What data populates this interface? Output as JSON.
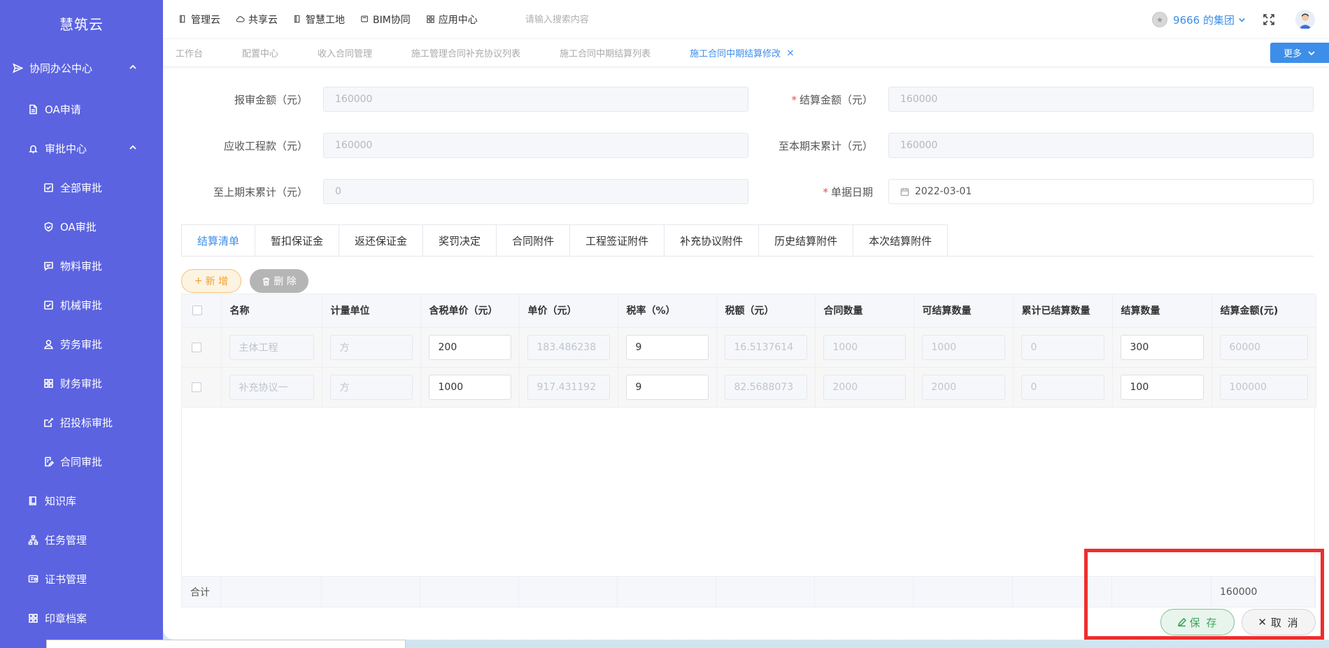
{
  "app": {
    "name": "慧筑云"
  },
  "sidebar": {
    "items": [
      {
        "label": "协同办公中心",
        "level": 1,
        "icon": "send-icon",
        "expanded": true
      },
      {
        "label": "OA申请",
        "level": 2,
        "icon": "document-icon"
      },
      {
        "label": "审批中心",
        "level": 2,
        "icon": "bell-icon",
        "expanded": true
      },
      {
        "label": "全部审批",
        "level": 3,
        "icon": "check-square-icon"
      },
      {
        "label": "OA审批",
        "level": 3,
        "icon": "shield-check-icon"
      },
      {
        "label": "物料审批",
        "level": 3,
        "icon": "message-icon"
      },
      {
        "label": "机械审批",
        "level": 3,
        "icon": "check-square-icon"
      },
      {
        "label": "劳务审批",
        "level": 3,
        "icon": "user-icon"
      },
      {
        "label": "财务审批",
        "level": 3,
        "icon": "grid-icon"
      },
      {
        "label": "招投标审批",
        "level": 3,
        "icon": "share-icon"
      },
      {
        "label": "合同审批",
        "level": 3,
        "icon": "edit-doc-icon"
      },
      {
        "label": "知识库",
        "level": 2,
        "icon": "book-icon"
      },
      {
        "label": "任务管理",
        "level": 2,
        "icon": "org-chart-icon"
      },
      {
        "label": "证书管理",
        "level": 2,
        "icon": "certificate-icon"
      },
      {
        "label": "印章档案",
        "level": 2,
        "icon": "grid-icon"
      }
    ]
  },
  "topbar": {
    "links": [
      {
        "label": "管理云",
        "icon": "doc-icon"
      },
      {
        "label": "共享云",
        "icon": "cloud-icon"
      },
      {
        "label": "智慧工地",
        "icon": "doc-icon"
      },
      {
        "label": "BIM协同",
        "icon": "folder-icon"
      },
      {
        "label": "应用中心",
        "icon": "grid-icon"
      }
    ],
    "search_placeholder": "请输入搜索内容",
    "org_name": "9666 的集团"
  },
  "page_tabs": {
    "items": [
      {
        "label": "工作台"
      },
      {
        "label": "配置中心"
      },
      {
        "label": "收入合同管理"
      },
      {
        "label": "施工管理合同补充协议列表"
      },
      {
        "label": "施工合同中期结算列表"
      },
      {
        "label": "施工合同中期结算修改",
        "active": true
      }
    ],
    "more_label": "更多"
  },
  "form": {
    "report_amount": {
      "label": "报审金额（元）",
      "value": "160000"
    },
    "settle_amount": {
      "label": "结算金额（元）",
      "value": "160000",
      "required": true
    },
    "receivable": {
      "label": "应收工程款（元）",
      "value": "160000"
    },
    "cum_this": {
      "label": "至本期末累计（元）",
      "value": "160000"
    },
    "cum_last": {
      "label": "至上期末累计（元）",
      "value": "0"
    },
    "doc_date": {
      "label": "单据日期",
      "value": "2022-03-01",
      "required": true
    }
  },
  "content_tabs": {
    "items": [
      "结算清单",
      "暂扣保证金",
      "返还保证金",
      "奖罚决定",
      "合同附件",
      "工程签证附件",
      "补充协议附件",
      "历史结算附件",
      "本次结算附件"
    ],
    "active_index": 0
  },
  "actions": {
    "add_label": "新 增",
    "delete_label": "删 除",
    "save_label": "保 存",
    "cancel_label": "取 消"
  },
  "table": {
    "headers": [
      "名称",
      "计量单位",
      "含税单价（元）",
      "单价（元）",
      "税率（%）",
      "税额（元）",
      "合同数量",
      "可结算数量",
      "累计已结算数量",
      "结算数量",
      "结算金额(元)"
    ],
    "rows": [
      [
        "主体工程",
        "方",
        "200",
        "183.486238",
        "9",
        "16.5137614",
        "1000",
        "1000",
        "0",
        "300",
        "60000"
      ],
      [
        "补充协议一",
        "方",
        "1000",
        "917.431192",
        "9",
        "82.5688073",
        "2000",
        "2000",
        "0",
        "100",
        "100000"
      ]
    ],
    "editable_columns": [
      2,
      4,
      9
    ],
    "total_label": "合计",
    "total_amount": "160000"
  }
}
